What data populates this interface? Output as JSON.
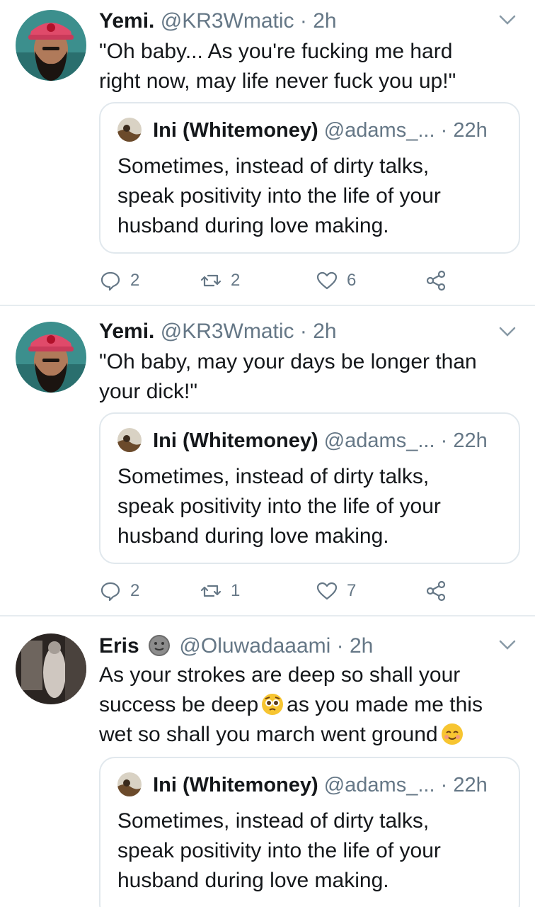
{
  "tweets": [
    {
      "author_name": "Yemi.",
      "handle": "@KR3Wmatic",
      "separator": "·",
      "time": "2h",
      "text_lines": [
        "\"Oh baby... As you're fucking me hard",
        "right now, may life never fuck you up!\""
      ],
      "quote": {
        "name": "Ini (Whitemoney)",
        "handle": "@adams_...",
        "separator": "·",
        "time": "22h",
        "text_lines": [
          "Sometimes, instead of dirty talks,",
          "speak positivity into the life of your",
          "husband during love making."
        ]
      },
      "actions": {
        "replies": "2",
        "retweets": "2",
        "likes": "6"
      }
    },
    {
      "author_name": "Yemi.",
      "handle": "@KR3Wmatic",
      "separator": "·",
      "time": "2h",
      "text_lines": [
        "\"Oh baby, may your days be longer than",
        "your dick!\""
      ],
      "quote": {
        "name": "Ini (Whitemoney)",
        "handle": "@adams_...",
        "separator": "·",
        "time": "22h",
        "text_lines": [
          "Sometimes, instead of dirty talks,",
          "speak positivity into the life of your",
          "husband during love making."
        ]
      },
      "actions": {
        "replies": "2",
        "retweets": "1",
        "likes": "7"
      }
    },
    {
      "author_name": "Eris",
      "handle": "@Oluwadaaami",
      "separator": "·",
      "time": "2h",
      "text_parts": {
        "line1": "As your strokes are deep so shall your",
        "line2_a": "success be deep",
        "line2_b": "as you made me this",
        "line3": "wet so shall you march went ground"
      },
      "quote": {
        "name": "Ini (Whitemoney)",
        "handle": "@adams_...",
        "separator": "·",
        "time": "22h",
        "text_lines": [
          "Sometimes, instead of dirty talks,",
          "speak positivity into the life of your",
          "husband during love making."
        ]
      }
    }
  ],
  "icons": {
    "reply": "reply-icon",
    "retweet": "retweet-icon",
    "like": "heart-icon",
    "share": "share-icon",
    "more": "chevron-down-icon",
    "emoji_name": "moon-face-emoji",
    "emoji_flushed": "pleading-face-emoji",
    "emoji_smile": "smiling-face-emoji"
  },
  "colors": {
    "text": "#14171a",
    "secondary": "#657786",
    "border": "#e1e8ed",
    "divider": "#e6ecf0"
  }
}
